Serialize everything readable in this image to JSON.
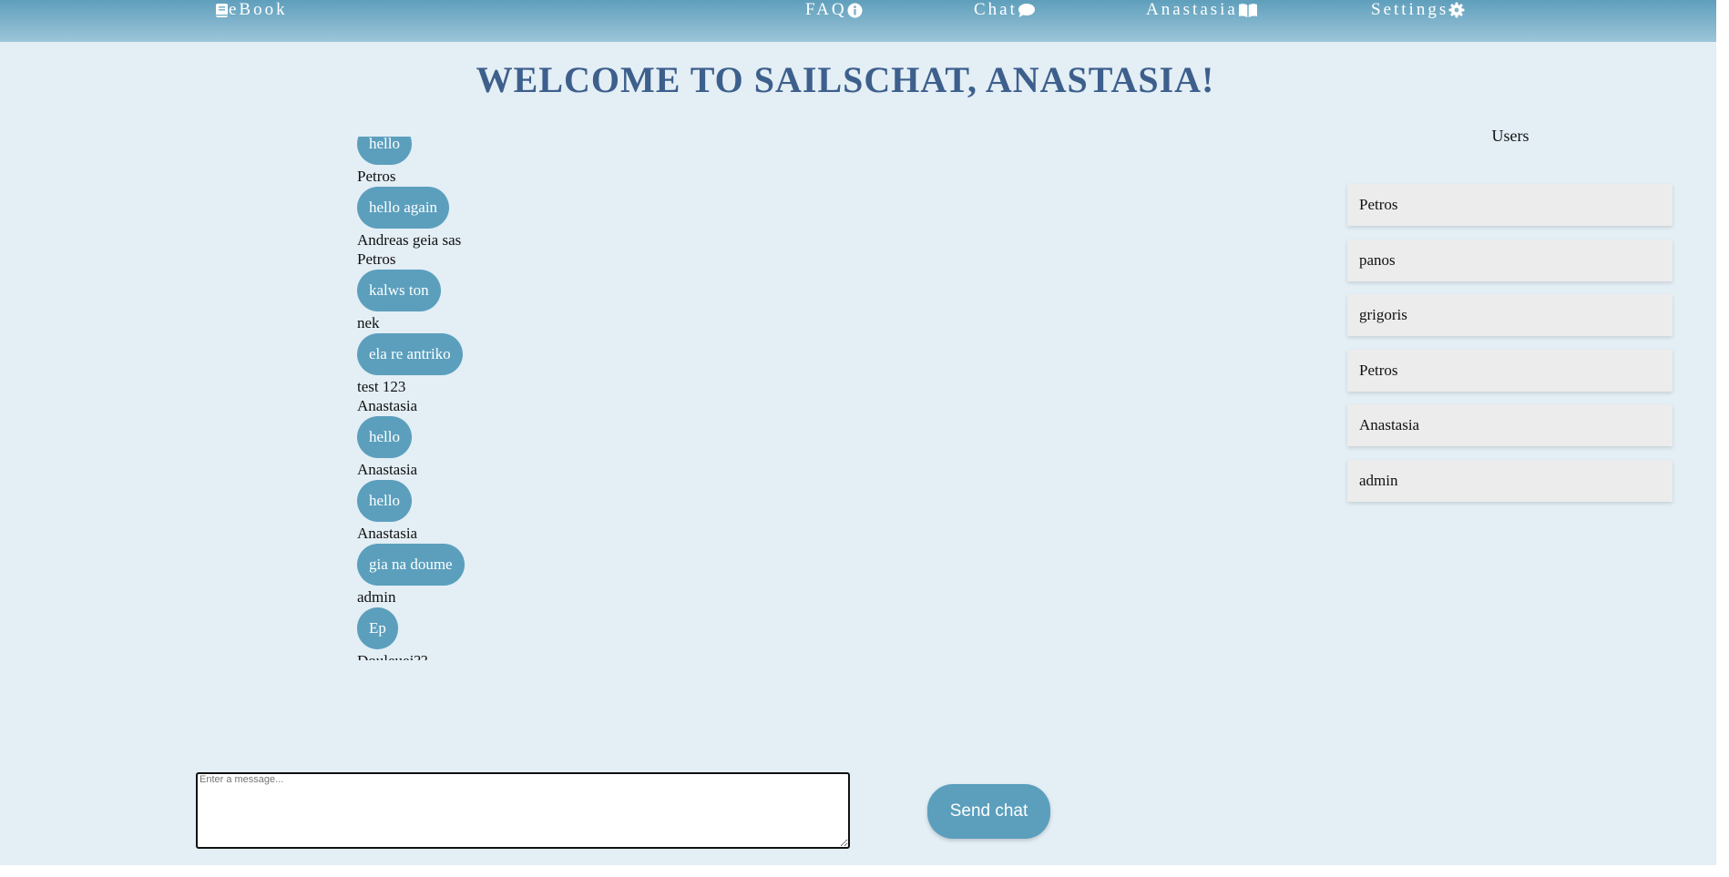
{
  "nav": {
    "ebook": "eBook",
    "faq": "FAQ",
    "chat": "Chat",
    "user": "Anastasia",
    "settings": "Settings"
  },
  "welcome": "WELCOME TO SAILSCHAT, ANASTASIA!",
  "chat": {
    "entries": [
      {
        "kind": "bubble",
        "text": "hello"
      },
      {
        "kind": "text",
        "text": "Petros"
      },
      {
        "kind": "bubble",
        "text": "hello again"
      },
      {
        "kind": "text",
        "text": "Andreas geia sas"
      },
      {
        "kind": "text",
        "text": "Petros"
      },
      {
        "kind": "bubble",
        "text": "kalws ton"
      },
      {
        "kind": "text",
        "text": "nek"
      },
      {
        "kind": "bubble",
        "text": "ela re antriko"
      },
      {
        "kind": "text",
        "text": "test 123"
      },
      {
        "kind": "text",
        "text": "Anastasia"
      },
      {
        "kind": "bubble",
        "text": "hello"
      },
      {
        "kind": "text",
        "text": "Anastasia"
      },
      {
        "kind": "bubble",
        "text": "hello"
      },
      {
        "kind": "text",
        "text": "Anastasia"
      },
      {
        "kind": "bubble",
        "text": "gia na doume"
      },
      {
        "kind": "text",
        "text": "admin"
      },
      {
        "kind": "bubble",
        "text": "Ep"
      },
      {
        "kind": "text",
        "text": "Douleuei??"
      }
    ]
  },
  "users": {
    "title": "Users",
    "list": [
      "Petros",
      "panos",
      "grigoris",
      "Petros",
      "Anastasia",
      "admin"
    ]
  },
  "composer": {
    "placeholder": "Enter a message...",
    "value": "",
    "send_label": "Send chat"
  },
  "colors": {
    "navbar_top": "#5f9fbc",
    "page_bg": "#e3eef5",
    "bubble": "#5b9fbd",
    "heading": "#3d5f8c",
    "user_card": "#ececec"
  },
  "icons": {
    "ebook": "book-icon",
    "faq": "info-circle-icon",
    "chat": "comment-icon",
    "user": "open-book-icon",
    "settings": "gear-icon"
  }
}
